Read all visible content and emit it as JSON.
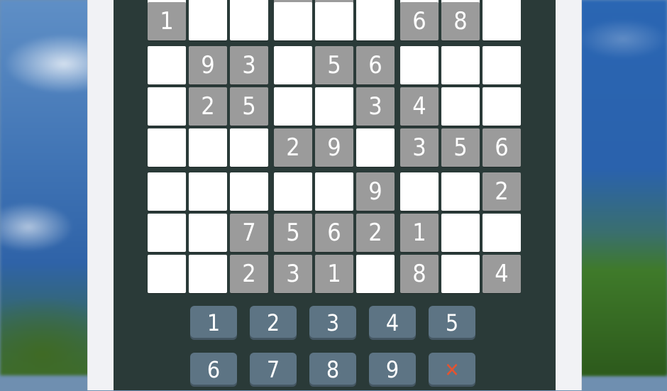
{
  "board": {
    "rows": [
      [
        "",
        "",
        "",
        "",
        "",
        "",
        "",
        "",
        ""
      ],
      [
        "1",
        "",
        "",
        "",
        "",
        "",
        "6",
        "8",
        ""
      ],
      [
        "",
        "9",
        "3",
        "",
        "5",
        "6",
        "",
        "",
        ""
      ],
      [
        "",
        "2",
        "5",
        "",
        "",
        "3",
        "4",
        "",
        ""
      ],
      [
        "",
        "",
        "",
        "2",
        "9",
        "",
        "3",
        "5",
        "6"
      ],
      [
        "",
        "",
        "",
        "",
        "",
        "9",
        "",
        "",
        "2"
      ],
      [
        "",
        "",
        "7",
        "5",
        "6",
        "2",
        "1",
        "",
        ""
      ],
      [
        "",
        "",
        "2",
        "3",
        "1",
        "",
        "8",
        "",
        "4"
      ]
    ],
    "given_mask": [
      [
        0,
        0,
        0,
        1,
        1,
        0,
        0,
        0,
        0
      ],
      [
        1,
        0,
        0,
        0,
        0,
        0,
        1,
        1,
        0
      ],
      [
        0,
        1,
        1,
        0,
        1,
        1,
        0,
        0,
        0
      ],
      [
        0,
        1,
        1,
        0,
        0,
        1,
        1,
        0,
        0
      ],
      [
        0,
        0,
        0,
        1,
        1,
        0,
        1,
        1,
        1
      ],
      [
        0,
        0,
        0,
        0,
        0,
        1,
        0,
        0,
        1
      ],
      [
        0,
        0,
        1,
        1,
        1,
        1,
        1,
        0,
        0
      ],
      [
        0,
        0,
        1,
        1,
        1,
        0,
        1,
        0,
        1
      ]
    ]
  },
  "numpad": {
    "row1": [
      "1",
      "2",
      "3",
      "4",
      "5"
    ],
    "row2": [
      "6",
      "7",
      "8",
      "9",
      "✕"
    ]
  },
  "colors": {
    "given_cell": "#9b9b9b",
    "empty_cell": "#ffffff",
    "key": "#5d7484",
    "clear_key_glyph": "#e5532f",
    "board_bg": "#2a3a38"
  }
}
